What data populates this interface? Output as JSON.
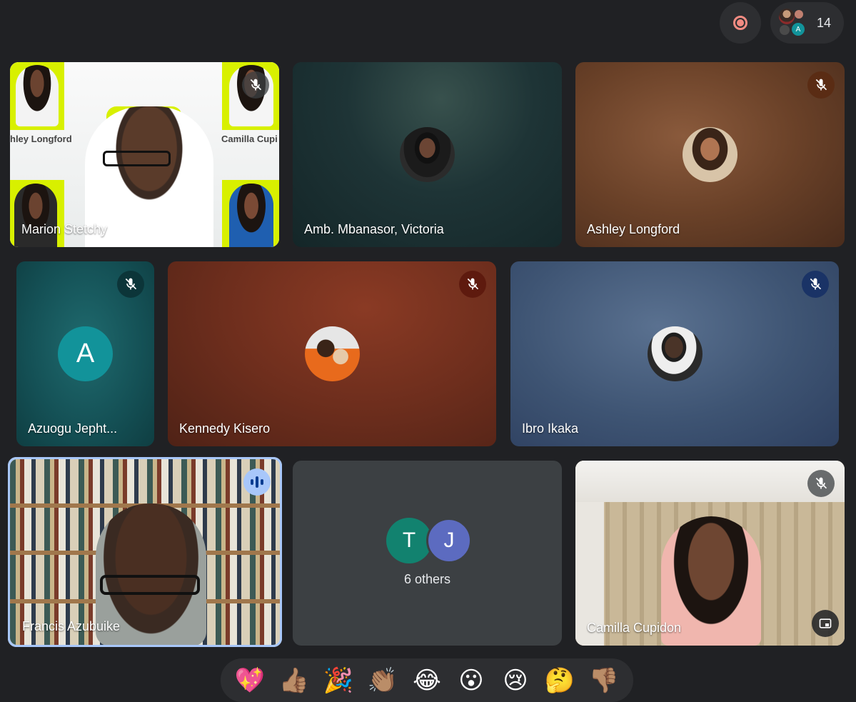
{
  "topbar": {
    "record_icon": "record-icon",
    "participants_count": "14",
    "participant_avatar_letter": "A"
  },
  "tiles": {
    "marion": {
      "name": "Marion Stetchy",
      "muted": true,
      "overlay_texts": [
        "hley Longford",
        "Camilla Cupi"
      ]
    },
    "victoria": {
      "name": "Amb. Mbanasor, Victoria",
      "muted": false
    },
    "ashley": {
      "name": "Ashley Longford",
      "muted": true
    },
    "azuogu": {
      "name": "Azuogu Jepht...",
      "muted": true,
      "avatar_letter": "A"
    },
    "kennedy": {
      "name": "Kennedy Kisero",
      "muted": true
    },
    "ibro": {
      "name": "Ibro Ikaka",
      "muted": true
    },
    "francis": {
      "name": "Francis Azubuike",
      "speaking": true
    },
    "others": {
      "label": "6 others",
      "avatar_letters": [
        "T",
        "J"
      ]
    },
    "camilla": {
      "name": "Camilla Cupidon",
      "muted": true
    }
  },
  "colors": {
    "background": "#202124",
    "accent_ring": "#a8c7fa",
    "record": "#f28b82"
  },
  "reactions": [
    "💖",
    "👍🏽",
    "🎉",
    "👏🏽",
    "😂",
    "😮",
    "😢",
    "🤔",
    "👎🏽"
  ]
}
